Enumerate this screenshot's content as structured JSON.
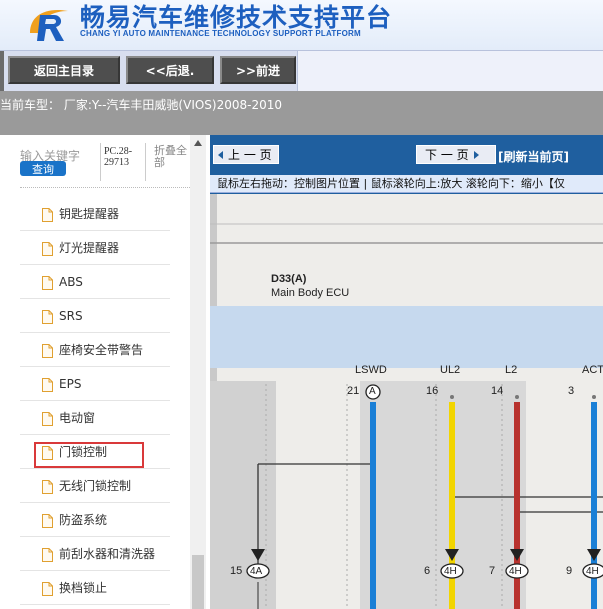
{
  "header": {
    "title": "畅易汽车维修技术支持平台",
    "subtitle": "CHANG YI AUTO MAINTENANCE TECHNOLOGY SUPPORT PLATFORM"
  },
  "toolbar": {
    "home": "返回主目录",
    "back": "<<后退.",
    "forward": ">>前进"
  },
  "vehicle": "当前车型： 厂家:Y--汽车丰田威驰(VIOS)2008-2010",
  "sidebar": {
    "search_placeholder": "输入关键字",
    "search_button": "查询",
    "pc_code": "PC.28-29713",
    "collapse_all": "折叠全部",
    "items": [
      {
        "label": "钥匙提醒器"
      },
      {
        "label": "灯光提醒器"
      },
      {
        "label": "ABS"
      },
      {
        "label": "SRS"
      },
      {
        "label": "座椅安全带警告"
      },
      {
        "label": "EPS"
      },
      {
        "label": "电动窗"
      },
      {
        "label": "门锁控制",
        "highlighted": true
      },
      {
        "label": "无线门锁控制"
      },
      {
        "label": "防盗系统"
      },
      {
        "label": "前刮水器和清洗器"
      },
      {
        "label": "换档锁止"
      }
    ]
  },
  "viewer": {
    "prev": "上 一 页",
    "next": "下 一 页",
    "refresh": "[刷新当前页]",
    "hint": "鼠标左右拖动：控制图片位置 | 鼠标滚轮向上:放大  滚轮向下：缩小【仅"
  },
  "diagram": {
    "component_code": "D33(A)",
    "component_name": "Main Body ECU",
    "pins": [
      {
        "name": "LSWD",
        "num": "21",
        "conn": "A",
        "bottom_num": "15",
        "bottom_conn": "4A",
        "wire_color": "#1a7fd6"
      },
      {
        "name": "UL2",
        "num": "16",
        "conn": "",
        "bottom_num": "6",
        "bottom_conn": "4H",
        "wire_color": "#f2d500"
      },
      {
        "name": "L2",
        "num": "14",
        "conn": "",
        "bottom_num": "7",
        "bottom_conn": "4H",
        "wire_color": "#b8322e"
      },
      {
        "name": "ACT",
        "num": "3",
        "conn": "",
        "bottom_num": "9",
        "bottom_conn": "4H",
        "wire_color": "#1a7fd6"
      }
    ]
  }
}
